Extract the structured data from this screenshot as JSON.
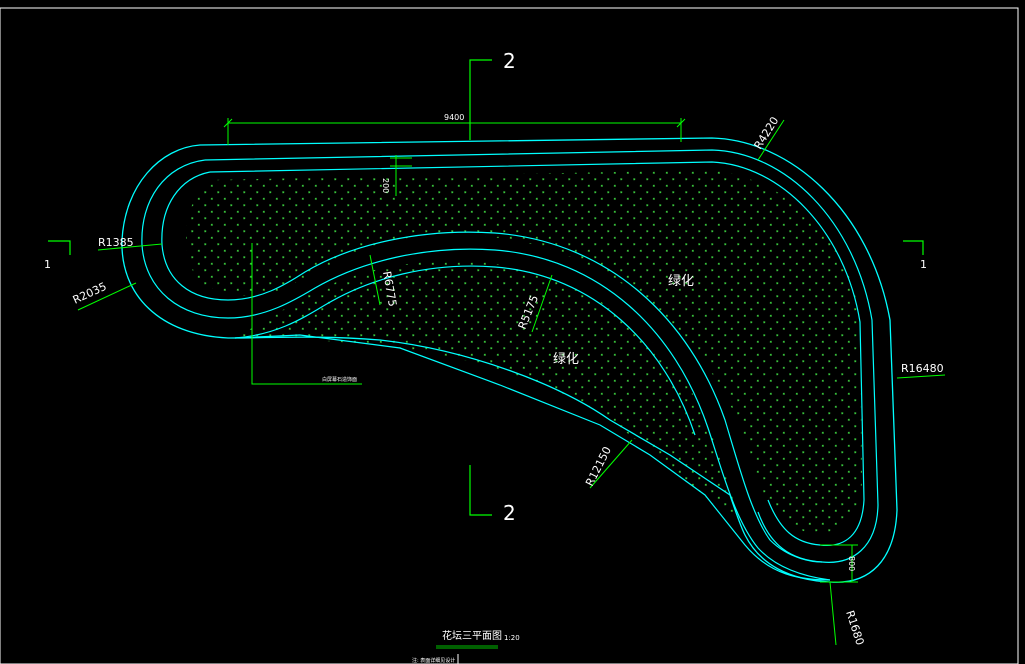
{
  "drawing": {
    "section_marks": [
      "2",
      "2",
      "1",
      "1"
    ],
    "dimensions": {
      "length": "9400",
      "gap": "200",
      "end_width": "800"
    },
    "radii": [
      "R4220",
      "R1385",
      "R2035",
      "R6775",
      "R5175",
      "R16480",
      "R12150",
      "R1680"
    ],
    "fill_labels": [
      "绿化",
      "绿化"
    ],
    "leader_note": "白屏幕石造饰面",
    "title": "花坛三平面图",
    "scale": "1:20",
    "footer_note": "注: 表面详细见设计"
  },
  "colors": {
    "background": "#000000",
    "outline": "#00ffff",
    "dimension": "#00ff00",
    "hatch": "#39c43c",
    "text": "#ffffff",
    "border": "#ffffff"
  }
}
